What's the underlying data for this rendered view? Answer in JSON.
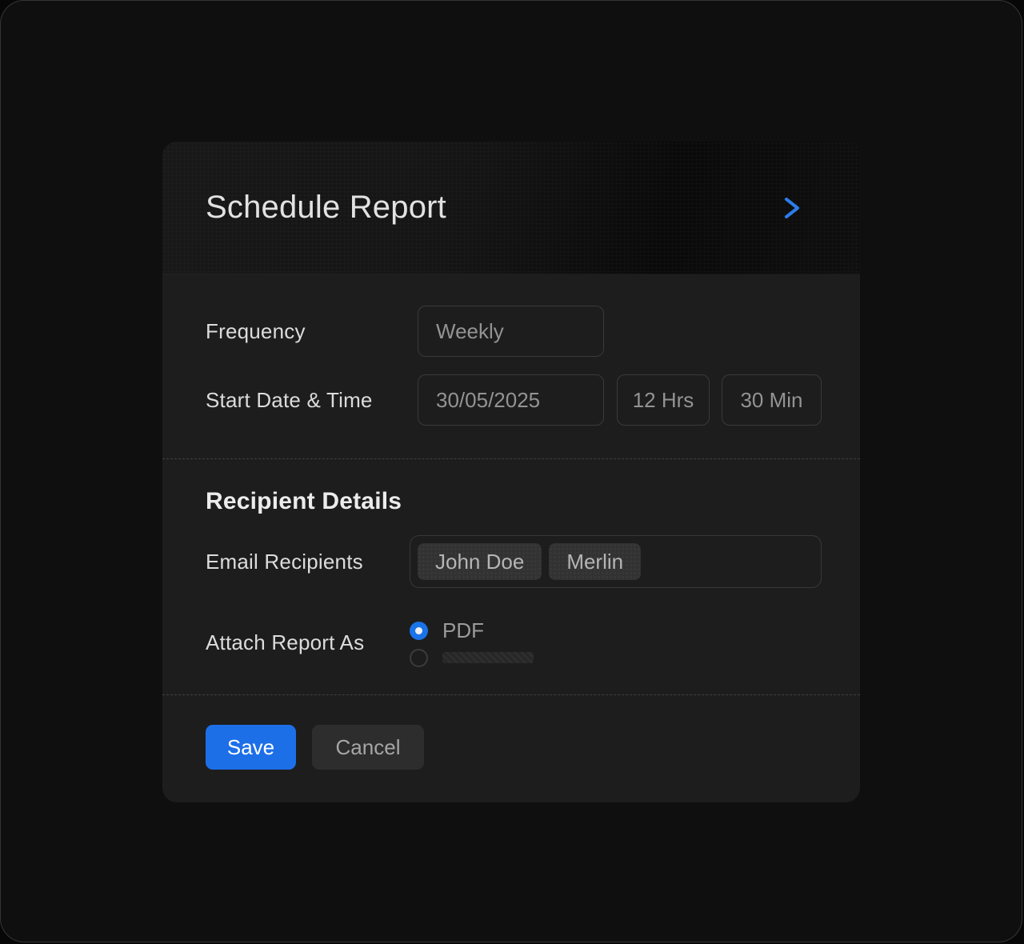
{
  "colors": {
    "accent_blue": "#1d6fe8",
    "chevron_blue": "#2b7de9",
    "radio_selected_blue": "#1a73e8",
    "card_background": "#1d1d1d",
    "page_background": "#0f0f0f"
  },
  "header": {
    "title": "Schedule Report",
    "chevron_icon": "chevron-right"
  },
  "schedule": {
    "frequency_label": "Frequency",
    "frequency_value": "Weekly",
    "start_label": "Start Date & Time",
    "date_value": "30/05/2025",
    "hours_value": "12 Hrs",
    "minutes_value": "30 Min"
  },
  "recipient": {
    "heading": "Recipient Details",
    "email_label": "Email Recipients",
    "chips": [
      "John Doe",
      "Merlin"
    ],
    "attach_label": "Attach Report As",
    "attach_options": [
      {
        "label": "PDF",
        "selected": true
      },
      {
        "label": "",
        "selected": false,
        "redacted": true
      }
    ]
  },
  "footer": {
    "save_label": "Save",
    "cancel_label": "Cancel"
  }
}
